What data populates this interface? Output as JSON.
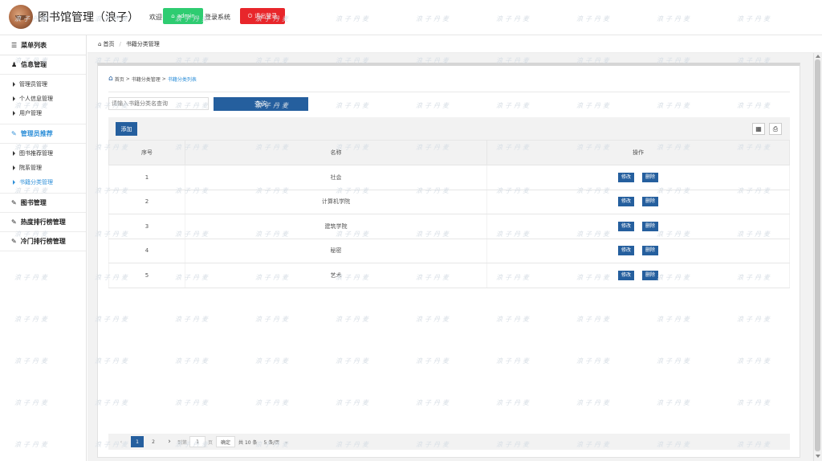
{
  "header": {
    "app_title": "图书馆管理（浪子）",
    "welcome": "欢迎",
    "admin_label": "admin",
    "login_system": "登录系统",
    "logout_label": "退出登录",
    "admin_color": "#2ecc71",
    "logout_color": "#e8262b"
  },
  "sidebar": {
    "menu_title": "菜单列表",
    "groups": [
      {
        "label": "信息管理",
        "items": [
          "管理员管理",
          "个人信息管理",
          "用户管理"
        ]
      },
      {
        "label": "管理员推荐",
        "items": [
          "图书推荐管理",
          "院系管理",
          "书籍分类管理"
        ]
      },
      {
        "label": "图书管理"
      },
      {
        "label": "热度排行榜管理"
      },
      {
        "label": "冷门排行榜管理"
      }
    ],
    "active_color": "#2e8fd8"
  },
  "top_breadcrumb": {
    "home": "首页",
    "current": "书籍分类管理"
  },
  "inner_breadcrumb": {
    "home": "首页",
    "level2": "书籍分类管理",
    "current": "书籍分类列表"
  },
  "search": {
    "placeholder": "请输入书籍分类名查询",
    "button": "查询"
  },
  "toolbar": {
    "add": "添加"
  },
  "table": {
    "headers": [
      "序号",
      "名称",
      "操作"
    ],
    "edit_label": "修改",
    "delete_label": "删除",
    "rows": [
      {
        "no": "1",
        "name": "社会"
      },
      {
        "no": "2",
        "name": "计算机学院"
      },
      {
        "no": "3",
        "name": "建筑学院"
      },
      {
        "no": "4",
        "name": "秘密"
      },
      {
        "no": "5",
        "name": "艺术"
      }
    ]
  },
  "pager": {
    "pages": [
      "1",
      "2"
    ],
    "current_page": "1",
    "goto_prefix": "到第",
    "goto_value": "1",
    "goto_suffix": "页",
    "confirm": "确定",
    "total": "共 10 条",
    "page_size": "5 条/页"
  },
  "watermark": "浪子丹麦",
  "accent_color": "#255f9e"
}
